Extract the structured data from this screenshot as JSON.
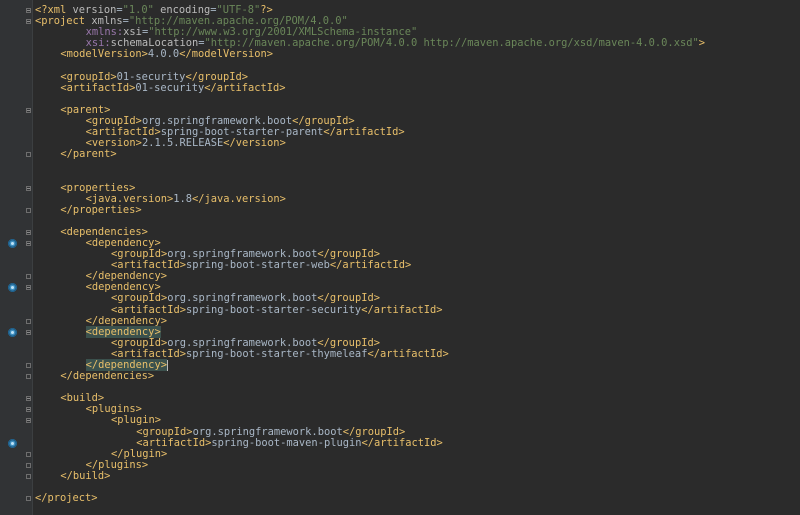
{
  "editor": {
    "lines": [
      {
        "indent": 0,
        "fold": "open",
        "tokens": [
          [
            "t",
            "<?xml "
          ],
          [
            "a",
            "version"
          ],
          [
            "x",
            "="
          ],
          [
            "s",
            "\"1.0\""
          ],
          [
            "x",
            " "
          ],
          [
            "a",
            "encoding"
          ],
          [
            "x",
            "="
          ],
          [
            "s",
            "\"UTF-8\""
          ],
          [
            "t",
            "?>"
          ]
        ]
      },
      {
        "indent": 0,
        "fold": "open",
        "tokens": [
          [
            "t",
            "<project "
          ],
          [
            "a",
            "xmlns"
          ],
          [
            "x",
            "="
          ],
          [
            "s",
            "\"http://maven.apache.org/POM/4.0.0\""
          ]
        ]
      },
      {
        "indent": 8,
        "tokens": [
          [
            "n",
            "xmlns:"
          ],
          [
            "a",
            "xsi"
          ],
          [
            "x",
            "="
          ],
          [
            "s",
            "\"http://www.w3.org/2001/XMLSchema-instance\""
          ]
        ]
      },
      {
        "indent": 8,
        "tokens": [
          [
            "n",
            "xsi:"
          ],
          [
            "a",
            "schemaLocation"
          ],
          [
            "x",
            "="
          ],
          [
            "s",
            "\"http://maven.apache.org/POM/4.0.0 http://maven.apache.org/xsd/maven-4.0.0.xsd\""
          ],
          [
            "t",
            ">"
          ]
        ]
      },
      {
        "indent": 4,
        "tokens": [
          [
            "t",
            "<modelVersion>"
          ],
          [
            "x",
            "4.0.0"
          ],
          [
            "t",
            "</modelVersion>"
          ]
        ]
      },
      {
        "indent": 0,
        "tokens": []
      },
      {
        "indent": 4,
        "tokens": [
          [
            "t",
            "<groupId>"
          ],
          [
            "x",
            "01-security"
          ],
          [
            "t",
            "</groupId>"
          ]
        ]
      },
      {
        "indent": 4,
        "tokens": [
          [
            "t",
            "<artifactId>"
          ],
          [
            "x",
            "01-security"
          ],
          [
            "t",
            "</artifactId>"
          ]
        ]
      },
      {
        "indent": 0,
        "tokens": []
      },
      {
        "indent": 4,
        "fold": "open",
        "tokens": [
          [
            "t",
            "<parent>"
          ]
        ]
      },
      {
        "indent": 8,
        "tokens": [
          [
            "t",
            "<groupId>"
          ],
          [
            "x",
            "org.springframework.boot"
          ],
          [
            "t",
            "</groupId>"
          ]
        ]
      },
      {
        "indent": 8,
        "tokens": [
          [
            "t",
            "<artifactId>"
          ],
          [
            "x",
            "spring-boot-starter-parent"
          ],
          [
            "t",
            "</artifactId>"
          ]
        ]
      },
      {
        "indent": 8,
        "tokens": [
          [
            "t",
            "<version>"
          ],
          [
            "x",
            "2.1.5.RELEASE"
          ],
          [
            "t",
            "</version>"
          ]
        ]
      },
      {
        "indent": 4,
        "fold": "close",
        "tokens": [
          [
            "t",
            "</parent>"
          ]
        ]
      },
      {
        "indent": 0,
        "tokens": []
      },
      {
        "indent": 0,
        "tokens": []
      },
      {
        "indent": 4,
        "fold": "open",
        "tokens": [
          [
            "t",
            "<properties>"
          ]
        ]
      },
      {
        "indent": 8,
        "tokens": [
          [
            "t",
            "<java.version>"
          ],
          [
            "x",
            "1.8"
          ],
          [
            "t",
            "</java.version>"
          ]
        ]
      },
      {
        "indent": 4,
        "fold": "close",
        "tokens": [
          [
            "t",
            "</properties>"
          ]
        ]
      },
      {
        "indent": 0,
        "tokens": []
      },
      {
        "indent": 4,
        "fold": "open",
        "tokens": [
          [
            "t",
            "<dependencies>"
          ]
        ]
      },
      {
        "indent": 8,
        "fold": "open",
        "icon": true,
        "tokens": [
          [
            "t",
            "<dependency>"
          ]
        ]
      },
      {
        "indent": 12,
        "tokens": [
          [
            "t",
            "<groupId>"
          ],
          [
            "x",
            "org.springframework.boot"
          ],
          [
            "t",
            "</groupId>"
          ]
        ]
      },
      {
        "indent": 12,
        "tokens": [
          [
            "t",
            "<artifactId>"
          ],
          [
            "x",
            "spring-boot-starter-web"
          ],
          [
            "t",
            "</artifactId>"
          ]
        ]
      },
      {
        "indent": 8,
        "fold": "close",
        "tokens": [
          [
            "t",
            "</dependency>"
          ]
        ]
      },
      {
        "indent": 8,
        "fold": "open",
        "icon": true,
        "tokens": [
          [
            "t",
            "<dependency>"
          ]
        ]
      },
      {
        "indent": 12,
        "tokens": [
          [
            "t",
            "<groupId>"
          ],
          [
            "x",
            "org.springframework.boot"
          ],
          [
            "t",
            "</groupId>"
          ]
        ]
      },
      {
        "indent": 12,
        "tokens": [
          [
            "t",
            "<artifactId>"
          ],
          [
            "x",
            "spring-boot-starter-security"
          ],
          [
            "t",
            "</artifactId>"
          ]
        ]
      },
      {
        "indent": 8,
        "fold": "close",
        "tokens": [
          [
            "t",
            "</dependency>"
          ]
        ]
      },
      {
        "indent": 8,
        "fold": "open",
        "icon": true,
        "highlight": true,
        "tokens": [
          [
            "t",
            "<dependency>"
          ]
        ]
      },
      {
        "indent": 12,
        "tokens": [
          [
            "t",
            "<groupId>"
          ],
          [
            "x",
            "org.springframework.boot"
          ],
          [
            "t",
            "</groupId>"
          ]
        ]
      },
      {
        "indent": 12,
        "tokens": [
          [
            "t",
            "<artifactId>"
          ],
          [
            "x",
            "spring-boot-starter-thymeleaf"
          ],
          [
            "t",
            "</artifactId>"
          ]
        ]
      },
      {
        "indent": 8,
        "fold": "close",
        "highlight": true,
        "caret": true,
        "tokens": [
          [
            "t",
            "</dependency>"
          ]
        ]
      },
      {
        "indent": 4,
        "fold": "close",
        "tokens": [
          [
            "t",
            "</dependencies>"
          ]
        ]
      },
      {
        "indent": 0,
        "tokens": []
      },
      {
        "indent": 4,
        "fold": "open",
        "tokens": [
          [
            "t",
            "<build>"
          ]
        ]
      },
      {
        "indent": 8,
        "fold": "open",
        "tokens": [
          [
            "t",
            "<plugins>"
          ]
        ]
      },
      {
        "indent": 12,
        "fold": "open",
        "tokens": [
          [
            "t",
            "<plugin>"
          ]
        ]
      },
      {
        "indent": 16,
        "tokens": [
          [
            "t",
            "<groupId>"
          ],
          [
            "x",
            "org.springframework.boot"
          ],
          [
            "t",
            "</groupId>"
          ]
        ]
      },
      {
        "indent": 16,
        "icon": true,
        "tokens": [
          [
            "t",
            "<artifactId>"
          ],
          [
            "x",
            "spring-boot-maven-plugin"
          ],
          [
            "t",
            "</artifactId>"
          ]
        ]
      },
      {
        "indent": 12,
        "fold": "close",
        "tokens": [
          [
            "t",
            "</plugin>"
          ]
        ]
      },
      {
        "indent": 8,
        "fold": "close",
        "tokens": [
          [
            "t",
            "</plugins>"
          ]
        ]
      },
      {
        "indent": 4,
        "fold": "close",
        "tokens": [
          [
            "t",
            "</build>"
          ]
        ]
      },
      {
        "indent": 0,
        "tokens": []
      },
      {
        "indent": 0,
        "fold": "close",
        "tokens": [
          [
            "t",
            "</project>"
          ]
        ]
      }
    ]
  },
  "colors": {
    "background": "#2b2b2b",
    "gutter": "#313335",
    "tag": "#e8bf6a",
    "string": "#6a8759",
    "text": "#a9b7c6",
    "highlight": "#3b514d"
  }
}
